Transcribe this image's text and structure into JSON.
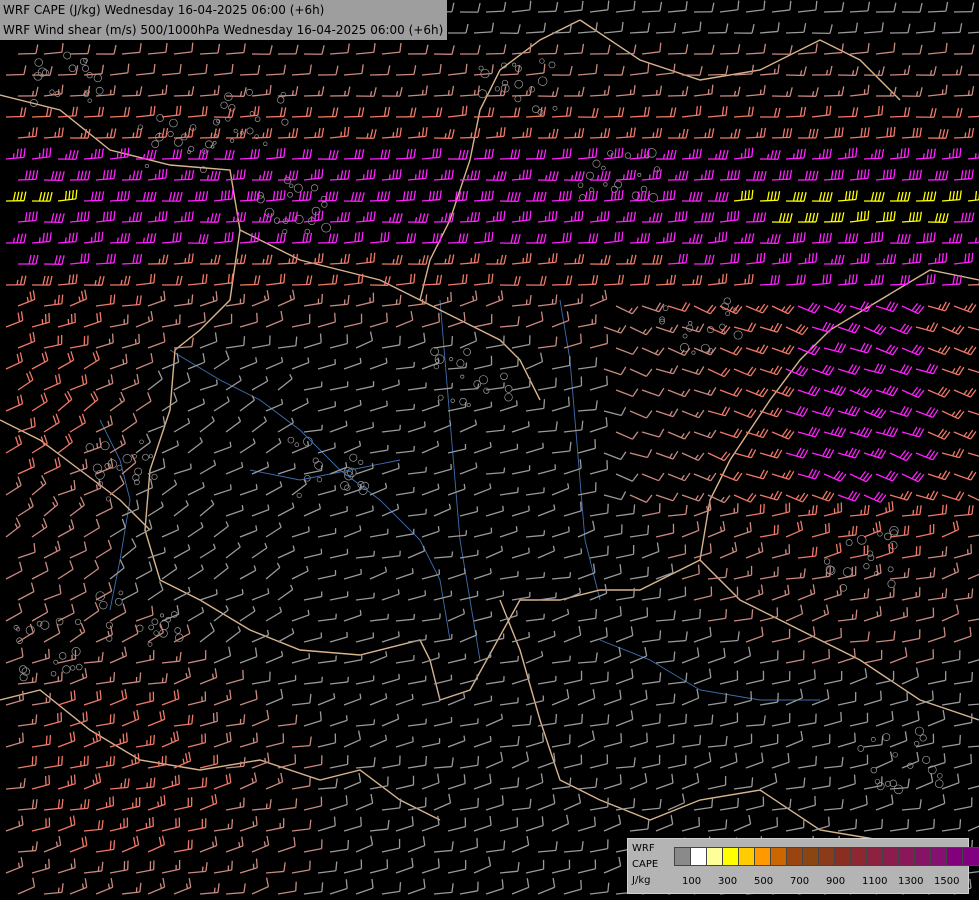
{
  "title": {
    "line1": "WRF CAPE (J/kg) Wednesday 16-04-2025 06:00 (+6h)",
    "line2": "WRF Wind shear (m/s) 500/1000hPa Wednesday 16-04-2025 06:00 (+6h)"
  },
  "legend": {
    "label_model": "WRF",
    "label_var": "CAPE",
    "label_unit": "J/kg",
    "colors": [
      "#8a8a8a",
      "#ffffff",
      "#ffff99",
      "#ffff00",
      "#ffcc00",
      "#ff9900",
      "#cc6600",
      "#994411",
      "#8b4513",
      "#8b3a1a",
      "#8b2e22",
      "#8c2832",
      "#8c2240",
      "#8a1c4e",
      "#88185a",
      "#861466",
      "#841070",
      "#82007c",
      "#800080"
    ],
    "ticks": [
      "100",
      "300",
      "500",
      "700",
      "900",
      "1100",
      "1300",
      "1500"
    ]
  },
  "map_colors": {
    "background": "#000000",
    "borders": "#d8b48c",
    "rivers": "#3f6fb0",
    "terrain": "#9a9a9a",
    "barb_low": "#9a9a9a",
    "barb_mid": "#c98a80",
    "barb_high": "#f07868",
    "barb_strong": "#ff20ff",
    "barb_extreme": "#ffff00"
  }
}
